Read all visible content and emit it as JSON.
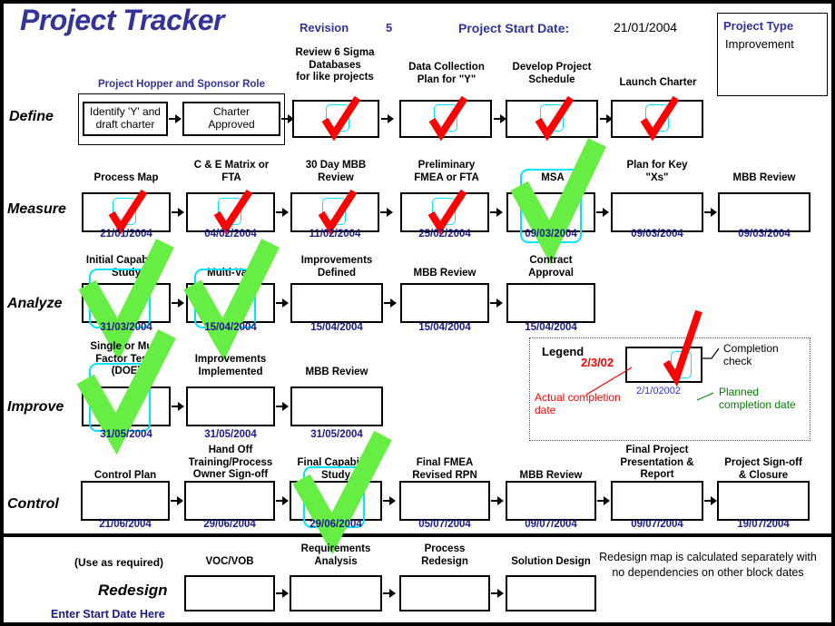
{
  "header": {
    "title": "Project Tracker",
    "revision_label": "Revision",
    "revision_value": "5",
    "start_date_label": "Project Start Date:",
    "start_date_value": "21/01/2004",
    "project_type_title": "Project Type",
    "project_type_value": "Improvement"
  },
  "colors": {
    "title_blue": "#333399",
    "date_blue": "#1a1a8c",
    "red_check": "#ff0000",
    "green_check": "#66ee44",
    "cyan_target": "#00e5ff",
    "legend_red": "#ff0000",
    "legend_green": "#008000"
  },
  "phases": [
    {
      "name": "Define",
      "label": "Define"
    },
    {
      "name": "Measure",
      "label": "Measure"
    },
    {
      "name": "Analyze",
      "label": "Analyze"
    },
    {
      "name": "Improve",
      "label": "Improve"
    },
    {
      "name": "Control",
      "label": "Control"
    },
    {
      "name": "Redesign",
      "label": "Redesign"
    }
  ],
  "hopper_label": "Project Hopper and Sponsor Role",
  "steps": {
    "define": [
      {
        "caption": "Identify 'Y' and\ndraft charter",
        "caption_inside": true,
        "date": "",
        "check": "none"
      },
      {
        "caption": "Charter\nApproved",
        "caption_inside": true,
        "date": "",
        "check": "none"
      },
      {
        "caption": "Review  6 Sigma\nDatabases\nfor like projects",
        "date": "",
        "check": "red"
      },
      {
        "caption": "Data Collection\nPlan for \"Y\"",
        "date": "",
        "check": "red"
      },
      {
        "caption": "Develop Project\nSchedule",
        "date": "",
        "check": "red"
      },
      {
        "caption": "Launch Charter",
        "date": "",
        "check": "red"
      }
    ],
    "measure": [
      {
        "caption": "Process Map",
        "date": "21/01/2004",
        "check": "red"
      },
      {
        "caption": "C & E Matrix or\nFTA",
        "date": "04/02/2004",
        "check": "red"
      },
      {
        "caption": "30 Day MBB\nReview",
        "date": "11/02/2004",
        "check": "red"
      },
      {
        "caption": "Preliminary\nFMEA or FTA",
        "date": "25/02/2004",
        "check": "red"
      },
      {
        "caption": "MSA",
        "date": "09/03/2004",
        "check": "green"
      },
      {
        "caption": "Plan for Key\n\"Xs\"",
        "date": "09/03/2004",
        "check": "none"
      },
      {
        "caption": "MBB Review",
        "date": "09/03/2004",
        "check": "none"
      }
    ],
    "analyze": [
      {
        "caption": "Initial Capability\nStudy",
        "date": "31/03/2004",
        "check": "green"
      },
      {
        "caption": "Multi-Vari",
        "date": "15/04/2004",
        "check": "green"
      },
      {
        "caption": "Improvements\nDefined",
        "date": "15/04/2004",
        "check": "none"
      },
      {
        "caption": "MBB Review",
        "date": "15/04/2004",
        "check": "none"
      },
      {
        "caption": "Contract\nApproval",
        "date": "15/04/2004",
        "check": "none"
      }
    ],
    "improve": [
      {
        "caption": "Single or Multi\nFactor Tests\n(DOE)",
        "date": "31/05/2004",
        "check": "green"
      },
      {
        "caption": "Improvements\nImplemented",
        "date": "31/05/2004",
        "check": "none"
      },
      {
        "caption": "MBB Review",
        "date": "31/05/2004",
        "check": "none"
      }
    ],
    "control": [
      {
        "caption": "Control Plan",
        "date": "21/06/2004",
        "check": "none"
      },
      {
        "caption": "Hand Off\nTraining/Process\nOwner Sign-off",
        "date": "29/06/2004",
        "check": "none"
      },
      {
        "caption": "Final Capability\nStudy",
        "date": "29/06/2004",
        "check": "green"
      },
      {
        "caption": "Final FMEA\nRevised RPN",
        "date": "05/07/2004",
        "check": "none"
      },
      {
        "caption": "MBB Review",
        "date": "09/07/2004",
        "check": "none"
      },
      {
        "caption": "Final Project\nPresentation &\nReport",
        "date": "09/07/2004",
        "check": "none"
      },
      {
        "caption": "Project Sign-off\n& Closure",
        "date": "19/07/2004",
        "check": "none"
      }
    ],
    "redesign": [
      {
        "caption": "VOC/VOB",
        "date": "",
        "check": "none"
      },
      {
        "caption": "Requirements\nAnalysis",
        "date": "",
        "check": "none"
      },
      {
        "caption": "Process\nRedesign",
        "date": "",
        "check": "none"
      },
      {
        "caption": "Solution Design",
        "date": "",
        "check": "none"
      }
    ]
  },
  "legend": {
    "title": "Legend",
    "actual_date_sample": "2/3/02",
    "planned_date_sample": "2/1/02002",
    "completion_check_label": "Completion\ncheck",
    "actual_label": "Actual completion\ndate",
    "planned_label": "Planned\ncompletion date"
  },
  "redesign_row": {
    "use_as_required": "(Use as required)",
    "note": "Redesign map is calculated separately with no dependencies on other block dates",
    "enter_start_date": "Enter Start Date Here"
  }
}
